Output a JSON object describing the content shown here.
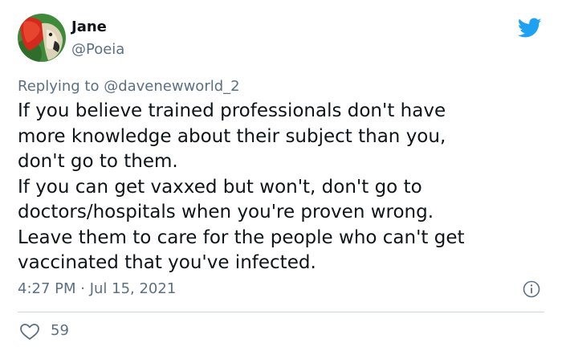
{
  "tweet": {
    "author": {
      "name": "Jane",
      "handle": "@Poeia"
    },
    "reply": {
      "prefix": "Replying to ",
      "mention": "@davenewworld_2"
    },
    "text_lines": [
      "If you believe trained professionals don't have",
      "more knowledge about their subject than you,",
      "don't go to them.",
      "If you can get vaxxed but won't, don't go to",
      "doctors/hospitals when you're proven wrong.",
      "Leave them to care for the people who can't get",
      "vaccinated that you've infected."
    ],
    "timestamp": "4:27 PM · Jul 15, 2021",
    "likes": "59"
  },
  "icons": {
    "brand": "twitter-bird-icon",
    "info": "info-icon",
    "like": "heart-icon"
  },
  "colors": {
    "brand": "#1da1f2",
    "text": "#0f1419",
    "secondary": "#5b7083",
    "divider": "#cfd9de"
  }
}
